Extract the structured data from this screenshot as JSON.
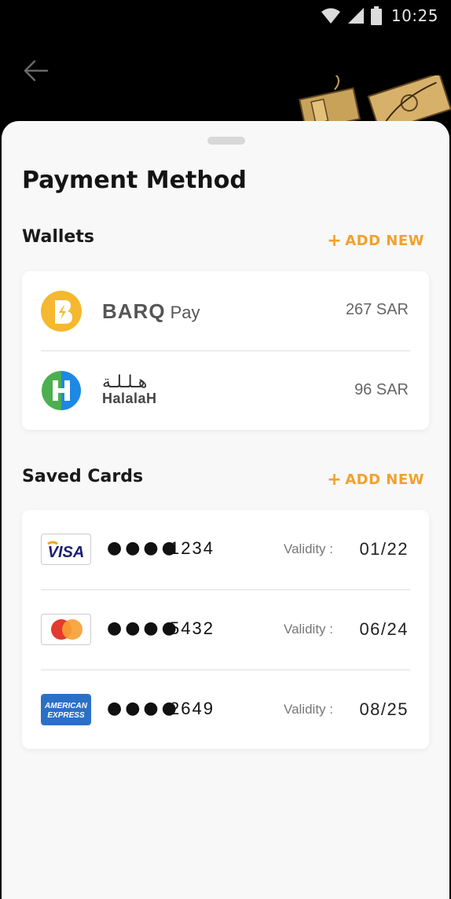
{
  "status_bar": {
    "time": "10:25"
  },
  "page": {
    "title": "Payment Method"
  },
  "wallets": {
    "heading": "Wallets",
    "add_new_label": "ADD NEW",
    "items": [
      {
        "name": "BARQ",
        "suffix": "Pay",
        "amount": "267 SAR",
        "icon": "baroq-pay-logo"
      },
      {
        "name_ar": "هـلـلـة",
        "name_en": "HalalaH",
        "amount": "96 SAR",
        "icon": "halalah-logo"
      }
    ]
  },
  "saved_cards": {
    "heading": "Saved Cards",
    "add_new_label": "ADD NEW",
    "items": [
      {
        "brand": "visa",
        "brand_text": "VISA",
        "masked": "●●●●",
        "last4": "1234",
        "validity_label": "Validity :",
        "validity": "01/22"
      },
      {
        "brand": "mastercard",
        "masked": "●●●●",
        "last4": "5432",
        "validity_label": "Validity :",
        "validity": "06/24"
      },
      {
        "brand": "amex",
        "brand_text_1": "AMERICAN",
        "brand_text_2": "EXPRESS",
        "masked": "●●●●",
        "last4": "2649",
        "validity_label": "Validity :",
        "validity": "08/25"
      }
    ]
  },
  "colors": {
    "accent": "#f2a12c",
    "baroq_yellow": "#f5b82e",
    "halalah_green": "#4caf50",
    "halalah_blue": "#1e88e5",
    "amex_blue": "#2a70c6",
    "visa_blue": "#1a1f71"
  }
}
